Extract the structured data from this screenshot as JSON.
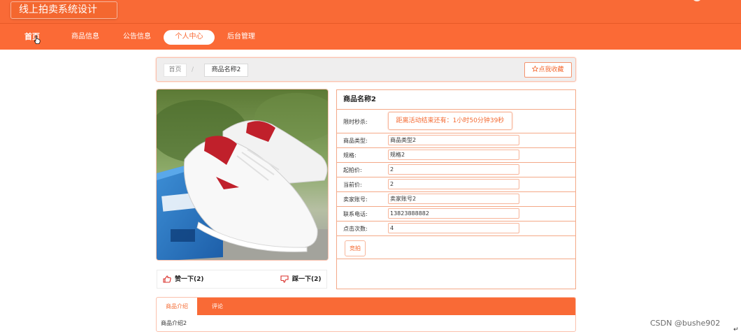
{
  "site": {
    "title": "线上拍卖系统设计"
  },
  "nav": {
    "items": [
      "首页",
      "商品信息",
      "公告信息",
      "个人中心",
      "后台管理"
    ],
    "active_index": 3
  },
  "breadcrumb": {
    "home": "首页",
    "separator": "/",
    "current": "商品名称2"
  },
  "favorite_button": {
    "icon": "star-icon",
    "label": "点我收藏"
  },
  "product": {
    "image_icon": "sneaker-photo",
    "title": "商品名称2",
    "flash_label": "限时秒杀:",
    "countdown": "距离活动结束还有：1小时50分钟39秒",
    "fields": [
      {
        "label": "商品类型:",
        "value": "商品类型2"
      },
      {
        "label": "规格:",
        "value": "规格2"
      },
      {
        "label": "起拍价:",
        "value": "2"
      },
      {
        "label": "当前价:",
        "value": "2"
      },
      {
        "label": "卖家账号:",
        "value": "卖家账号2"
      },
      {
        "label": "联系电话:",
        "value": "13823888882"
      },
      {
        "label": "点击次数:",
        "value": "4"
      }
    ],
    "bid_button": "竞拍"
  },
  "votes": {
    "up": {
      "icon": "thumbs-up-icon",
      "label": "赞一下(2)"
    },
    "down": {
      "icon": "thumbs-down-icon",
      "label": "踩一下(2)"
    }
  },
  "tabs": {
    "items": [
      "商品介绍",
      "评论"
    ],
    "active_index": 0,
    "content": "商品介绍2"
  },
  "watermark": "CSDN @bushe902",
  "colors": {
    "accent": "#f96a36",
    "border": "#f4a988"
  }
}
